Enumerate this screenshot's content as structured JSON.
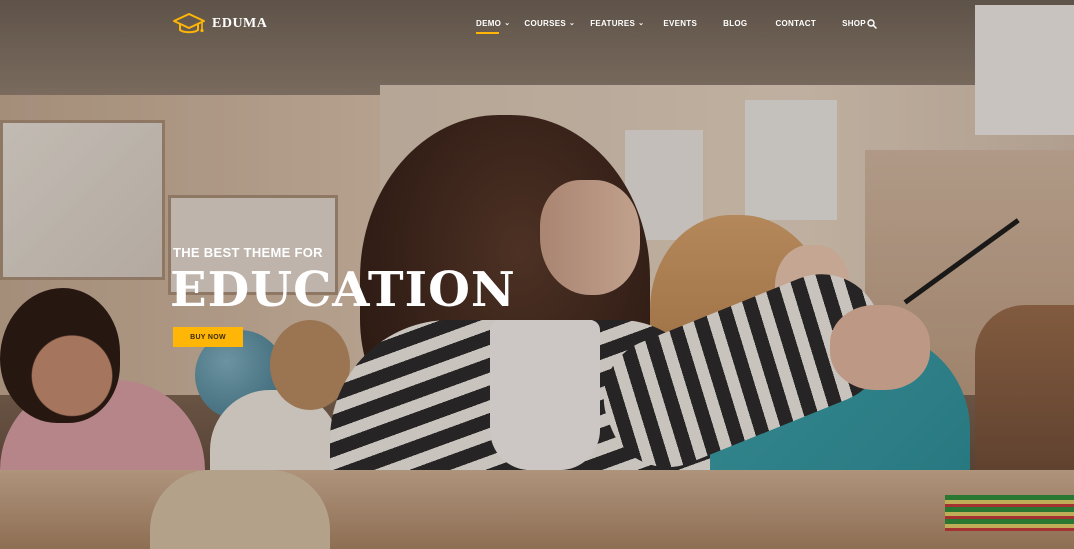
{
  "brand": {
    "name": "EDUMA",
    "accent_color": "#ffb606"
  },
  "nav": {
    "items": [
      {
        "label": "DEMO",
        "has_dropdown": true,
        "active": true
      },
      {
        "label": "COURSES",
        "has_dropdown": true,
        "active": false
      },
      {
        "label": "FEATURES",
        "has_dropdown": true,
        "active": false
      },
      {
        "label": "EVENTS",
        "has_dropdown": false,
        "active": false
      },
      {
        "label": "BLOG",
        "has_dropdown": false,
        "active": false
      },
      {
        "label": "CONTACT",
        "has_dropdown": false,
        "active": false
      },
      {
        "label": "SHOP",
        "has_dropdown": false,
        "active": false
      }
    ],
    "search_icon": "search-icon",
    "dropdown_icon": "chevron-down-icon"
  },
  "hero": {
    "subtitle": "THE BEST THEME FOR",
    "title": "EDUCATION",
    "cta_label": "BUY NOW"
  }
}
